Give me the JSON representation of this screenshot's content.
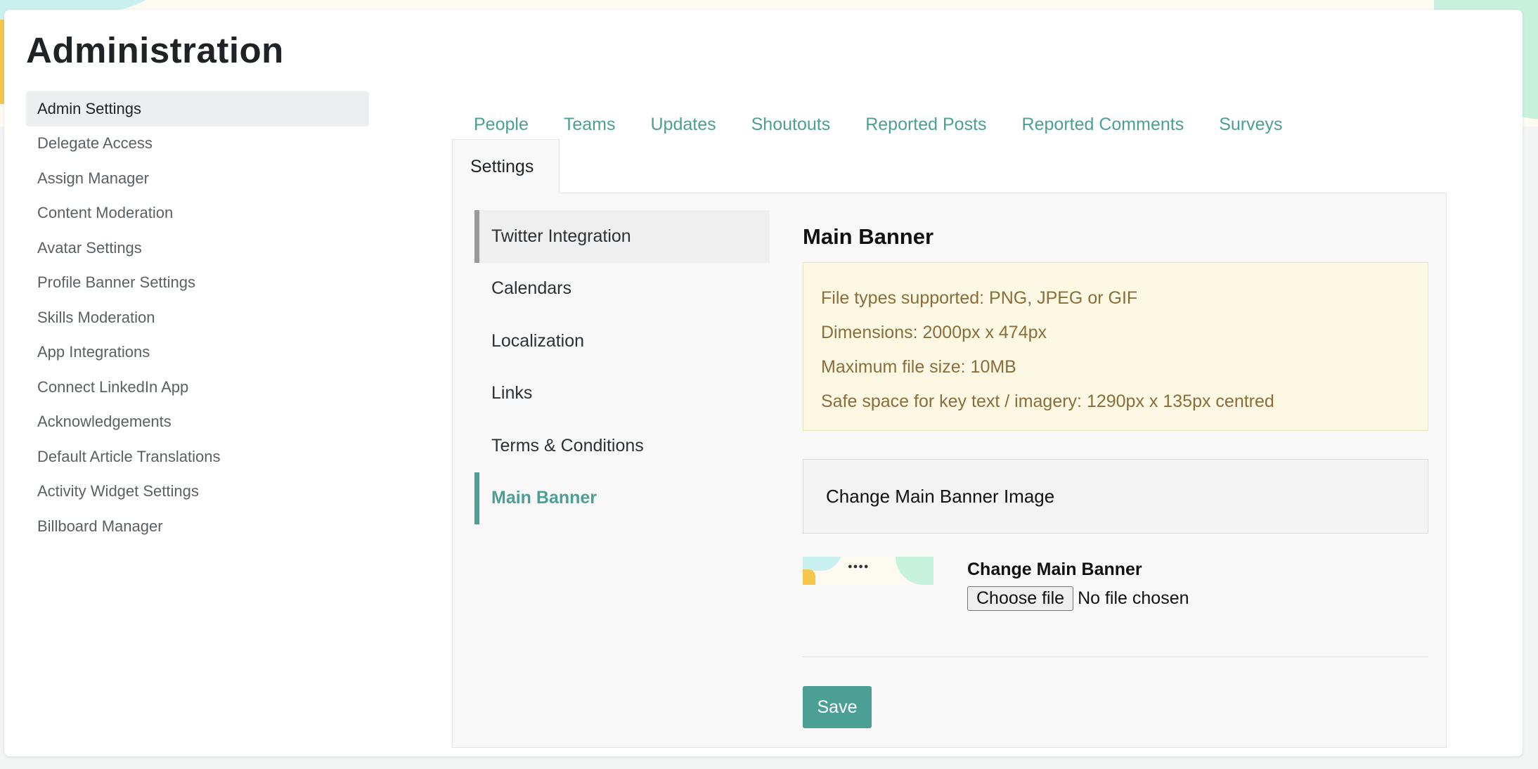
{
  "page": {
    "title": "Administration"
  },
  "left_nav": {
    "items": [
      {
        "label": "Admin Settings",
        "active": true
      },
      {
        "label": "Delegate Access"
      },
      {
        "label": "Assign Manager"
      },
      {
        "label": "Content Moderation"
      },
      {
        "label": "Avatar Settings"
      },
      {
        "label": "Profile Banner Settings"
      },
      {
        "label": "Skills Moderation"
      },
      {
        "label": "App Integrations"
      },
      {
        "label": "Connect LinkedIn App"
      },
      {
        "label": "Acknowledgements"
      },
      {
        "label": "Default Article Translations"
      },
      {
        "label": "Activity Widget Settings"
      },
      {
        "label": "Billboard Manager"
      }
    ]
  },
  "tabs": {
    "items": [
      {
        "label": "People"
      },
      {
        "label": "Teams"
      },
      {
        "label": "Updates"
      },
      {
        "label": "Shoutouts"
      },
      {
        "label": "Reported Posts"
      },
      {
        "label": "Reported Comments"
      },
      {
        "label": "Surveys"
      }
    ],
    "active_label": "Settings"
  },
  "subnav": {
    "items": [
      {
        "label": "Twitter Integration"
      },
      {
        "label": "Calendars"
      },
      {
        "label": "Localization"
      },
      {
        "label": "Links"
      },
      {
        "label": "Terms & Conditions"
      },
      {
        "label": "Main Banner",
        "active": true
      }
    ]
  },
  "content": {
    "title": "Main Banner",
    "info": [
      "File types supported: PNG, JPEG or GIF",
      "Dimensions: 2000px x 474px",
      "Maximum file size: 10MB",
      "Safe space for key text / imagery: 1290px x 135px centred"
    ],
    "change_header": "Change Main Banner Image",
    "upload_label": "Change Main Banner",
    "file_button": "Choose file",
    "file_status": "No file chosen",
    "save_label": "Save"
  },
  "colors": {
    "accent": "#4c9f95",
    "info_bg": "#fcf8e3",
    "info_text": "#8a6d3b"
  }
}
